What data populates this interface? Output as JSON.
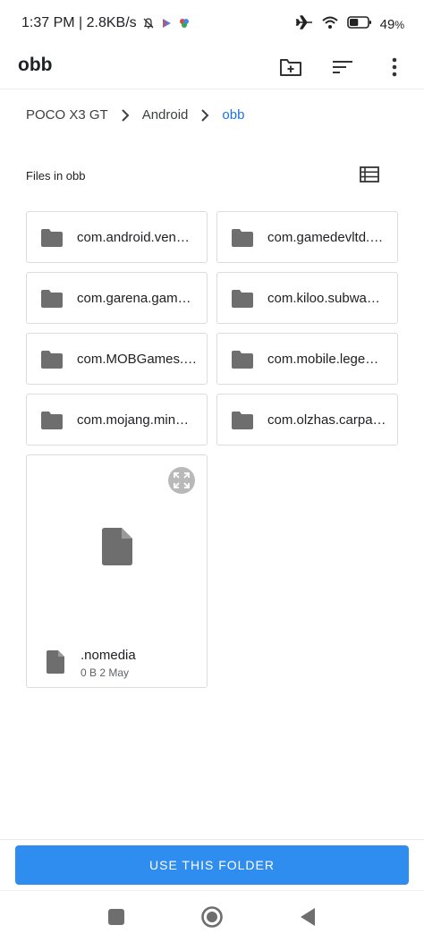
{
  "status_bar": {
    "time_speed": "1:37 PM | 2.8KB/s",
    "battery_percent": "49",
    "battery_suffix": "%",
    "battery_level": 0.49,
    "icons": [
      "mute-bell-icon",
      "play-store-icon",
      "app-notification-icon",
      "airplane-icon",
      "wifi-icon",
      "battery-icon"
    ]
  },
  "app_bar": {
    "title": "obb",
    "actions": [
      "new-folder-icon",
      "sort-icon",
      "more-vert-icon"
    ]
  },
  "breadcrumb": [
    "POCO X3 GT",
    "Android",
    "obb"
  ],
  "files_section": {
    "title": "Files in obb"
  },
  "folders": [
    "com.android.ven…",
    "com.gamedevltd.…",
    "com.garena.gam…",
    "com.kiloo.subwa…",
    "com.MOBGames.…",
    "com.mobile.lege…",
    "com.mojang.min…",
    "com.olzhas.carpa…"
  ],
  "file": {
    "name": ".nomedia",
    "size": "0 B",
    "date": "2 May"
  },
  "primary_action": {
    "label": "USE THIS FOLDER"
  },
  "colors": {
    "accent": "#1a73e8",
    "button": "#2f8df0",
    "icon_grey": "#6e6e6e"
  }
}
